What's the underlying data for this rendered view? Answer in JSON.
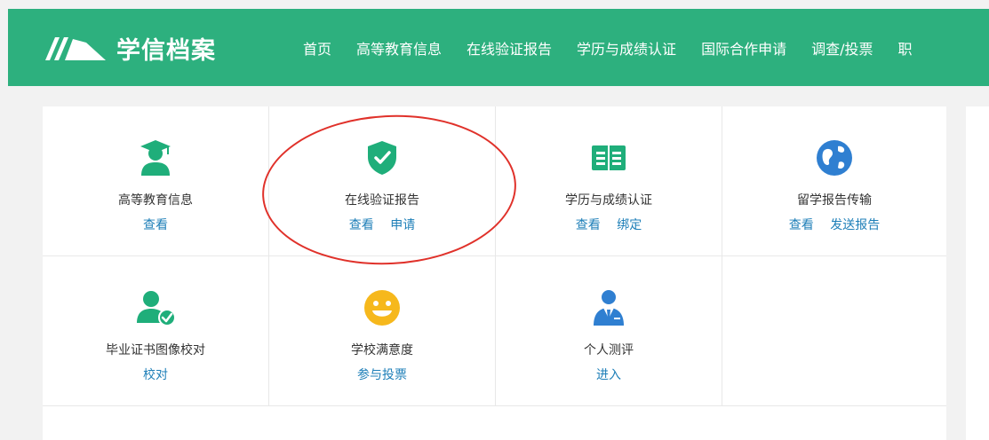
{
  "header": {
    "logo_text": "学信档案",
    "nav": [
      "首页",
      "高等教育信息",
      "在线验证报告",
      "学历与成绩认证",
      "国际合作申请",
      "调查/投票",
      "职"
    ]
  },
  "services": [
    {
      "title": "高等教育信息",
      "icon": "graduate-icon",
      "actions": [
        "查看"
      ]
    },
    {
      "title": "在线验证报告",
      "icon": "shield-check-icon",
      "actions": [
        "查看",
        "申请"
      ]
    },
    {
      "title": "学历与成绩认证",
      "icon": "book-icon",
      "actions": [
        "查看",
        "绑定"
      ]
    },
    {
      "title": "留学报告传输",
      "icon": "globe-icon",
      "actions": [
        "查看",
        "发送报告"
      ]
    },
    {
      "title": "毕业证书图像校对",
      "icon": "user-check-icon",
      "actions": [
        "校对"
      ]
    },
    {
      "title": "学校满意度",
      "icon": "smiley-icon",
      "actions": [
        "参与投票"
      ]
    },
    {
      "title": "个人测评",
      "icon": "person-tie-icon",
      "actions": [
        "进入"
      ]
    }
  ],
  "colors": {
    "brand_green": "#2db07e",
    "icon_green": "#1fae7a",
    "icon_blue": "#2f7fd1",
    "icon_yellow": "#f6b81c",
    "link_blue": "#1e7fb8",
    "highlight_red": "#e0312a"
  }
}
